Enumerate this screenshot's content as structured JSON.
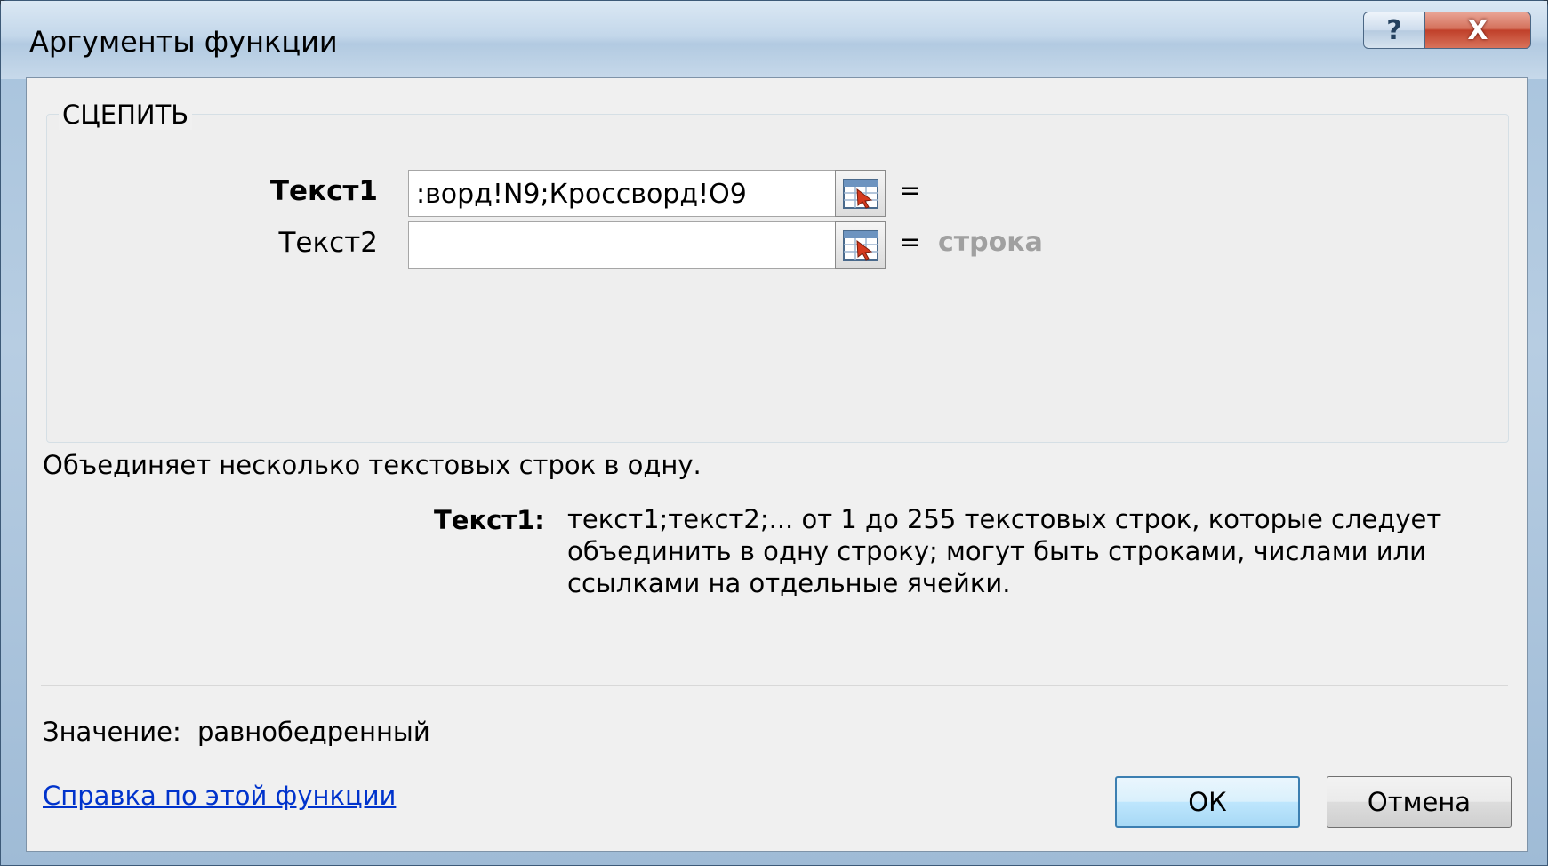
{
  "window": {
    "title": "Аргументы функции",
    "help_button": "?",
    "close_button": "X"
  },
  "function": {
    "name": "СЦЕПИТЬ",
    "args": [
      {
        "label": "Текст1",
        "value": ":ворд!N9;Кроссворд!O9",
        "equals": "=",
        "result": ""
      },
      {
        "label": "Текст2",
        "value": "",
        "equals": "=",
        "result": "строка"
      }
    ],
    "description": "Объединяет несколько текстовых строк в одну.",
    "arg_help_label": "Текст1:",
    "arg_help_text": "текст1;текст2;... от 1 до 255 текстовых строк, которые следует объединить в одну строку; могут быть строками, числами или ссылками на отдельные ячейки."
  },
  "value": {
    "label": "Значение:",
    "text": "равнобедренный"
  },
  "footer": {
    "help_link": "Справка по этой функции",
    "ok_label": "ОК",
    "cancel_label": "Отмена"
  },
  "icons": {
    "ref_button": "collapse-dialog-icon"
  }
}
